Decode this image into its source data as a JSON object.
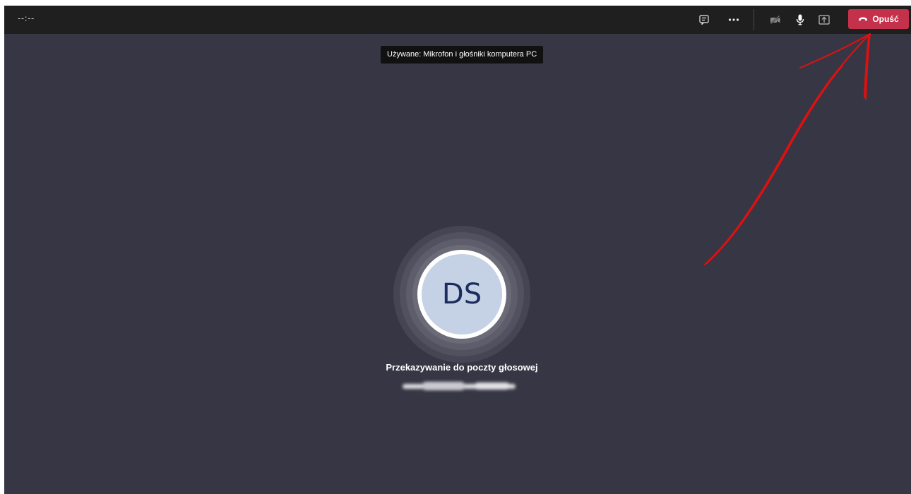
{
  "call": {
    "timer": "--:--",
    "leave_label": "Opuść",
    "leave_color": "#c4314b"
  },
  "toolbar": {
    "icons": [
      "chat-icon",
      "more-options-icon",
      "camera-off-icon",
      "microphone-icon",
      "share-screen-icon",
      "hang-up-icon"
    ]
  },
  "tooltip": {
    "text": "Używane: Mikrofon i głośniki komputera PC"
  },
  "participant": {
    "initials": "DS",
    "status": "Przekazywanie do poczty głosowej"
  },
  "colors": {
    "background": "#373644",
    "topbar": "#1f1f1f",
    "avatar_bg": "#c5d1e4",
    "avatar_text": "#1b2d5c",
    "annotation": "#e01010"
  }
}
